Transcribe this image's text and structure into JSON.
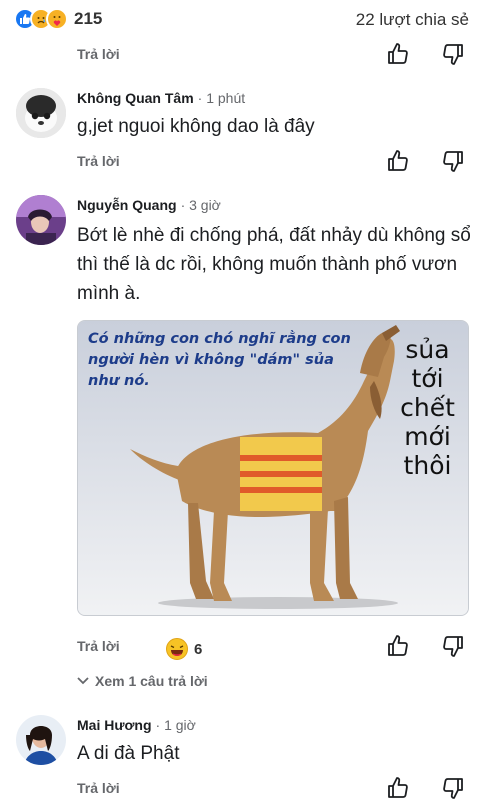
{
  "post": {
    "reaction_icons": [
      "like-icon",
      "sad-icon",
      "care-icon"
    ],
    "reaction_count": "215",
    "share_text": "22 lượt chia sẻ",
    "reply_label": "Trả lời"
  },
  "comments": [
    {
      "author": "Không Quan Tâm",
      "time": "· 1 phút",
      "text": "g,jet nguoi không dao là đây",
      "reply_label": "Trả lời"
    },
    {
      "author": "Nguyễn Quang",
      "time": "· 3 giờ",
      "text": "Bớt lè nhè đi chống phá, đất nhảy dù không sổ thì thế là dc rồi, không muốn thành phố vươn mình à.",
      "image": {
        "caption": "Có những con chó nghĩ rằng con người hèn vì không \"dám\" sủa như nó.",
        "side_text": "sủa tới chết mới thôi"
      },
      "reply_label": "Trả lời",
      "reaction_count": "6",
      "view_replies": "Xem 1 câu trả lời"
    },
    {
      "author": "Mai Hương",
      "time": "· 1 giờ",
      "text": "A di đà Phật",
      "reply_label": "Trả lời"
    }
  ],
  "colors": {
    "like_blue": "#1877f2",
    "text_gray": "#65676b",
    "caption_blue": "#1d3c8a"
  }
}
